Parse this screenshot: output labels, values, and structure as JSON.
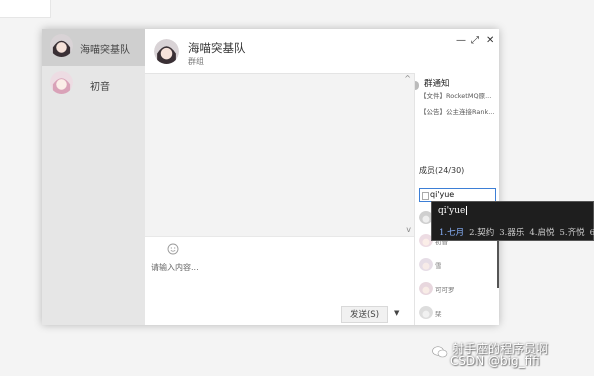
{
  "sidebar": {
    "conversations": [
      {
        "name": "海喵突基队",
        "active": true
      },
      {
        "name": "初音",
        "active": false
      }
    ]
  },
  "header": {
    "group_name": "海喵突基队",
    "group_sub": "群组",
    "minimize": "—",
    "maximize": "⤢",
    "close": "✕"
  },
  "chat": {
    "input_placeholder": "请输入内容...",
    "send_label": "发送(S)",
    "send_dropdown": "▼",
    "scroll_up": "^",
    "scroll_down": "v"
  },
  "group_panel": {
    "announcement_title": "群通知",
    "announcements": [
      "【文件】RocketMQ原...",
      "【公告】公主连接Rank..."
    ],
    "members_title": "成员(24/30)",
    "member_search_value": "qi'yue",
    "members": [
      {
        "name": ""
      },
      {
        "name": "初音"
      },
      {
        "name": "雪"
      },
      {
        "name": "可可罗"
      },
      {
        "name": "栞"
      }
    ]
  },
  "ime": {
    "composition": "qi'yue",
    "candidates": [
      "1.七月",
      "2.契约",
      "3.器乐",
      "4.启悦",
      "5.齐悦",
      "6"
    ]
  },
  "watermark": {
    "line1": "射手座的程序员啊",
    "line2": "CSDN @big_fifi"
  }
}
